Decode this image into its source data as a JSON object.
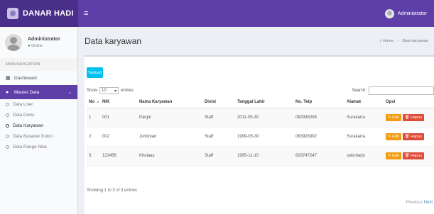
{
  "app": {
    "logo_text": "DANAR HADI",
    "user_menu_label": "Administrator"
  },
  "sidebar": {
    "user_name": "Administrator",
    "user_status": "Online",
    "nav_header": "MAIN NAVIGATION",
    "dashboard_label": "Dashboard",
    "master_data_label": "Master Data",
    "sub_items": [
      {
        "label": "Data User"
      },
      {
        "label": "Data Divisi"
      },
      {
        "label": "Data Karyawan"
      },
      {
        "label": "Data Basaran Kunci"
      },
      {
        "label": "Data Range Nilai"
      }
    ]
  },
  "page": {
    "title": "Data karyawan",
    "breadcrumb_home": "Home",
    "breadcrumb_current": "Data karyawan",
    "add_button": "Tambah",
    "show_label": "Show",
    "show_value": "10",
    "entries_label": "entries",
    "search_label": "Search:",
    "info": "Showing 1 to 3 of 3 entries",
    "prev": "Previous",
    "next": "Next"
  },
  "table": {
    "headers": [
      "No",
      "NIK",
      "Nama Karyawan",
      "Divisi",
      "Tanggal Lahir",
      "No. Telp",
      "Alamat",
      "Opsi"
    ],
    "rows": [
      {
        "no": "1",
        "nik": "001",
        "nama": "Panjul",
        "divisi": "Staff",
        "tgl": "2011-05-30",
        "telp": "082938298",
        "alamat": "Surakarta"
      },
      {
        "no": "2",
        "nik": "002",
        "nama": "Jumintan",
        "divisi": "Staff",
        "tgl": "1999-05-30",
        "telp": "083928392",
        "alamat": "Surakarta"
      },
      {
        "no": "3",
        "nik": "123456",
        "nama": "Khoiaas",
        "divisi": "Staff",
        "tgl": "1995-11-10",
        "telp": "829747247",
        "alamat": "sukoharjo"
      }
    ],
    "edit_label": "Edit",
    "delete_label": "Hapus"
  },
  "colors": {
    "header_dark": "#4a2f8a",
    "header": "#5e3fa8",
    "add_button": "#00c0ef",
    "edit_button": "#f39c12",
    "delete_button": "#dd4b39"
  }
}
